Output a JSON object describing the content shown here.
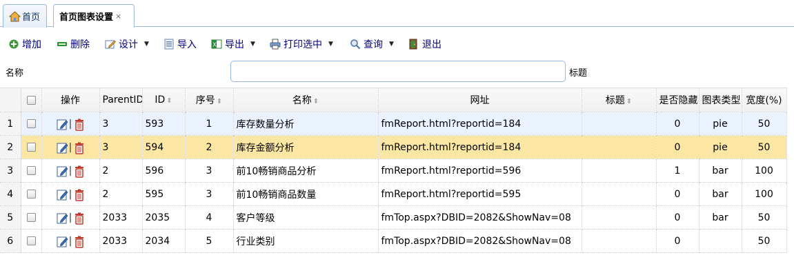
{
  "tabs": {
    "home_label": "首页",
    "active_label": "首页图表设置",
    "close_glyph": "×"
  },
  "toolbar": {
    "add": "增加",
    "delete": "删除",
    "design": "设计",
    "import": "导入",
    "export": "导出",
    "print": "打印选中",
    "query": "查询",
    "exit": "退出"
  },
  "search": {
    "name_label": "名称",
    "title_label": "标题",
    "name_value": ""
  },
  "grid": {
    "columns": {
      "ops": "操作",
      "parent_id": "ParentID",
      "id": "ID",
      "seq": "序号",
      "name": "名称",
      "url": "网址",
      "title": "标题",
      "hidden": "是否隐藏",
      "chart_type": "图表类型",
      "width": "宽度(%)"
    },
    "rows": [
      {
        "rn": "1",
        "parent_id": "3",
        "id": "593",
        "seq": "1",
        "name": "库存数量分析",
        "url": "fmReport.html?reportid=184",
        "title": "",
        "hidden": "0",
        "chart_type": "pie",
        "width": "50"
      },
      {
        "rn": "2",
        "parent_id": "3",
        "id": "594",
        "seq": "2",
        "name": "库存金额分析",
        "url": "fmReport.html?reportid=184",
        "title": "",
        "hidden": "0",
        "chart_type": "pie",
        "width": "50"
      },
      {
        "rn": "3",
        "parent_id": "2",
        "id": "596",
        "seq": "3",
        "name": "前10畅销商品分析",
        "url": "fmReport.html?reportid=596",
        "title": "",
        "hidden": "1",
        "chart_type": "bar",
        "width": "100"
      },
      {
        "rn": "4",
        "parent_id": "2",
        "id": "595",
        "seq": "3",
        "name": "前10畅销商品数量",
        "url": "fmReport.html?reportid=595",
        "title": "",
        "hidden": "0",
        "chart_type": "bar",
        "width": "100"
      },
      {
        "rn": "5",
        "parent_id": "2033",
        "id": "2035",
        "seq": "4",
        "name": "客户等级",
        "url": "fmTop.aspx?DBID=2082&ShowNav=08",
        "title": "",
        "hidden": "0",
        "chart_type": "bar",
        "width": "50"
      },
      {
        "rn": "6",
        "parent_id": "2033",
        "id": "2034",
        "seq": "5",
        "name": "行业类别",
        "url": "fmTop.aspx?DBID=2082&ShowNav=08",
        "title": "",
        "hidden": "0",
        "chart_type": "",
        "width": "50"
      }
    ]
  },
  "icons": {
    "home": "home-icon",
    "add": "add-circle-icon",
    "delete": "remove-bar-icon",
    "design": "design-edit-icon",
    "import": "import-sheet-icon",
    "export": "excel-export-icon",
    "print": "printer-icon",
    "query": "magnifier-icon",
    "exit": "exit-door-icon",
    "row_edit": "edit-pencil-icon",
    "row_delete": "trash-icon"
  },
  "colors": {
    "border_accent": "#95b8e7",
    "toolbar_text": "#000080",
    "selected_row": "#fbe7a3",
    "hover_row": "#eaf2ff"
  }
}
